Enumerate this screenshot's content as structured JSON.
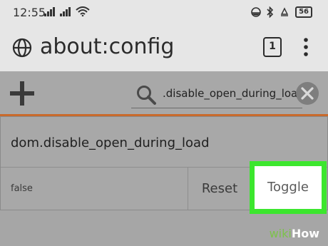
{
  "status_bar": {
    "time": "12:55",
    "battery": "56"
  },
  "url_bar": {
    "title": "about:config",
    "tab_count": "1"
  },
  "search": {
    "value": ".disable_open_during_load"
  },
  "preference": {
    "name": "dom.disable_open_during_load",
    "value": "false",
    "reset_label": "Reset",
    "toggle_label": "Toggle"
  },
  "watermark": {
    "prefix": "wiki",
    "suffix": "How"
  },
  "colors": {
    "highlight": "#3ce62e",
    "accent_line": "#c96a2c"
  }
}
